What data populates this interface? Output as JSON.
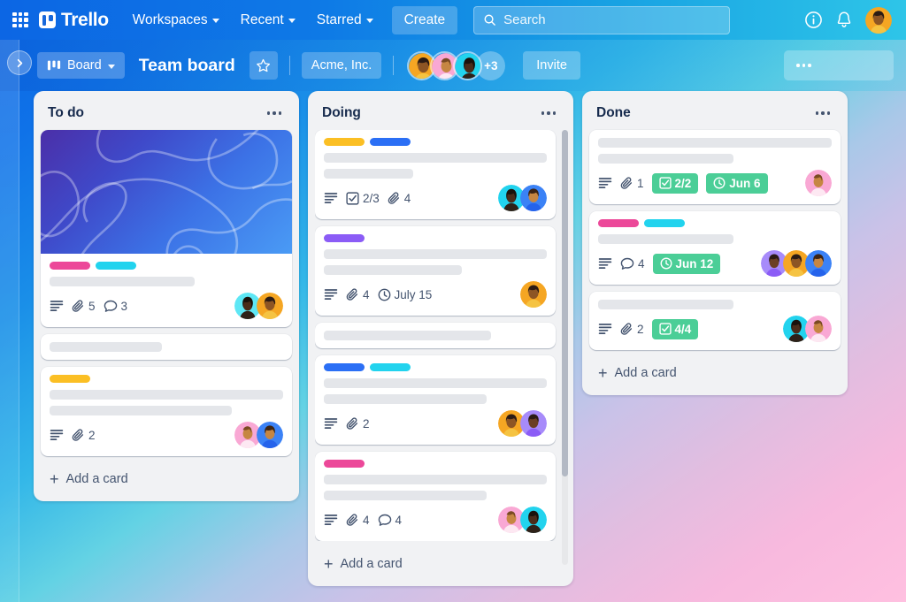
{
  "topnav": {
    "apps_icon": "grid-apps-icon",
    "brand": "Trello",
    "menus": [
      {
        "label": "Workspaces"
      },
      {
        "label": "Recent"
      },
      {
        "label": "Starred"
      }
    ],
    "create_label": "Create",
    "search": {
      "placeholder": "Search",
      "value": "",
      "icon": "search-icon"
    },
    "info_icon": "info-circle-icon",
    "notifications_icon": "bell-icon",
    "account_avatar": "user-avatar"
  },
  "boardbar": {
    "view_label": "Board",
    "view_icon": "board-view-icon",
    "title": "Team board",
    "star_icon": "star-icon",
    "workspace": "Acme, Inc.",
    "members_overflow": "+3",
    "invite_label": "Invite",
    "menu_icon": "ellipsis-icon"
  },
  "sidebar": {
    "expand_icon": "chevron-right-icon"
  },
  "lists": [
    {
      "title": "To do",
      "menu_icon": "ellipsis-icon",
      "add_card_label": "Add a card",
      "cards": [
        {
          "has_cover": true,
          "cover_colors": [
            "#4b2fa8",
            "#4a9bf5"
          ],
          "labels": [
            "#ec4899",
            "#22d3ee"
          ],
          "title_lines": [
            62
          ],
          "badges": [
            {
              "type": "description",
              "icon": "description-icon"
            },
            {
              "type": "attachment",
              "icon": "attachment-icon",
              "value": "5"
            },
            {
              "type": "comment",
              "icon": "comment-icon",
              "value": "3"
            }
          ],
          "avatars": [
            "#5ee7f5",
            "#f5a623"
          ]
        },
        {
          "has_cover": false,
          "labels": [],
          "title_lines": [
            48
          ],
          "badges": [],
          "avatars": []
        },
        {
          "has_cover": false,
          "labels": [
            "#fbbf24"
          ],
          "title_lines": [
            100,
            78
          ],
          "badges": [
            {
              "type": "description",
              "icon": "description-icon"
            },
            {
              "type": "attachment",
              "icon": "attachment-icon",
              "value": "2"
            }
          ],
          "avatars": [
            "#f9a8d4",
            "#3b82f6"
          ]
        }
      ]
    },
    {
      "title": "Doing",
      "menu_icon": "ellipsis-icon",
      "add_card_label": "Add a card",
      "scrollable": true,
      "cards": [
        {
          "has_cover": false,
          "labels": [
            "#fbbf24",
            "#2b6ff5"
          ],
          "title_lines": [
            100,
            40
          ],
          "badges": [
            {
              "type": "description",
              "icon": "description-icon"
            },
            {
              "type": "checklist",
              "icon": "checklist-icon",
              "value": "2/3"
            },
            {
              "type": "attachment",
              "icon": "attachment-icon",
              "value": "4"
            }
          ],
          "avatars": [
            "#22d3ee",
            "#3b82f6"
          ]
        },
        {
          "has_cover": false,
          "labels": [
            "#8b5cf6"
          ],
          "title_lines": [
            100,
            62
          ],
          "badges": [
            {
              "type": "description",
              "icon": "description-icon"
            },
            {
              "type": "attachment",
              "icon": "attachment-icon",
              "value": "4"
            },
            {
              "type": "due",
              "icon": "clock-icon",
              "value": "July 15"
            }
          ],
          "avatars": [
            "#f5a623"
          ]
        },
        {
          "has_cover": false,
          "labels": [],
          "title_lines": [
            75
          ],
          "badges": [],
          "avatars": []
        },
        {
          "has_cover": false,
          "labels": [
            "#2b6ff5",
            "#22d3ee"
          ],
          "title_lines": [
            100,
            73
          ],
          "badges": [
            {
              "type": "description",
              "icon": "description-icon"
            },
            {
              "type": "attachment",
              "icon": "attachment-icon",
              "value": "2"
            }
          ],
          "avatars": [
            "#f5a623",
            "#a78bfa"
          ]
        },
        {
          "has_cover": false,
          "labels": [
            "#ec4899"
          ],
          "title_lines": [
            100,
            73
          ],
          "badges": [
            {
              "type": "description",
              "icon": "description-icon"
            },
            {
              "type": "attachment",
              "icon": "attachment-icon",
              "value": "4"
            },
            {
              "type": "comment",
              "icon": "comment-icon",
              "value": "4"
            }
          ],
          "avatars": [
            "#f9a8d4",
            "#22d3ee"
          ]
        }
      ]
    },
    {
      "title": "Done",
      "menu_icon": "ellipsis-icon",
      "add_card_label": "Add a card",
      "cards": [
        {
          "has_cover": false,
          "labels": [],
          "title_lines": [
            100,
            58
          ],
          "badges": [
            {
              "type": "description",
              "icon": "description-icon"
            },
            {
              "type": "attachment",
              "icon": "attachment-icon",
              "value": "1"
            },
            {
              "type": "checklist-complete",
              "icon": "checklist-icon",
              "value": "2/2",
              "color": "#4bce97"
            },
            {
              "type": "due-complete",
              "icon": "clock-icon",
              "value": "Jun 6",
              "color": "#4bce97"
            }
          ],
          "avatars": [
            "#f9a8d4"
          ]
        },
        {
          "has_cover": false,
          "labels": [
            "#ec4899",
            "#22d3ee"
          ],
          "title_lines": [
            58
          ],
          "badges": [
            {
              "type": "description",
              "icon": "description-icon"
            },
            {
              "type": "comment",
              "icon": "comment-icon",
              "value": "4"
            },
            {
              "type": "due-complete",
              "icon": "clock-icon",
              "value": "Jun 12",
              "color": "#4bce97"
            }
          ],
          "avatars": [
            "#a78bfa",
            "#f5a623",
            "#3b82f6"
          ]
        },
        {
          "has_cover": false,
          "labels": [],
          "title_lines": [
            58
          ],
          "badges": [
            {
              "type": "description",
              "icon": "description-icon"
            },
            {
              "type": "attachment",
              "icon": "attachment-icon",
              "value": "2"
            },
            {
              "type": "checklist-complete",
              "icon": "checklist-icon",
              "value": "4/4",
              "color": "#4bce97"
            }
          ],
          "avatars": [
            "#22d3ee",
            "#f9a8d4"
          ]
        }
      ]
    }
  ],
  "colors": {
    "brand_blue": "#0c66e4",
    "list_bg": "#f1f2f4",
    "card_bg": "#ffffff",
    "text_dark": "#172b4d",
    "text_sub": "#44546f",
    "green_badge": "#4bce97"
  }
}
